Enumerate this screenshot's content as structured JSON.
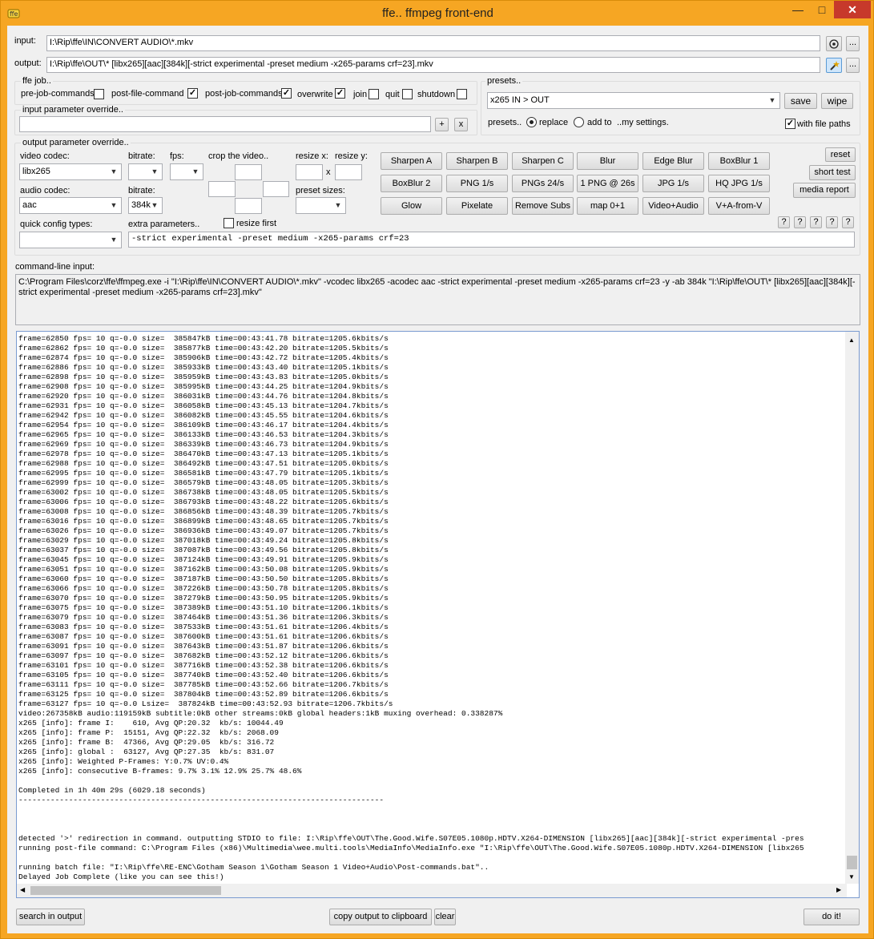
{
  "window": {
    "title": "ffe.. ffmpeg front-end",
    "minimize": "—",
    "maximize": "□",
    "close": "✕"
  },
  "input": {
    "label": "input:",
    "value": "I:\\Rip\\ffe\\IN\\CONVERT AUDIO\\*.mkv"
  },
  "output": {
    "label": "output:",
    "value": "I:\\Rip\\ffe\\OUT\\* [libx265][aac][384k][-strict experimental -preset medium -x265-params crf=23].mkv"
  },
  "browse_label": "...",
  "ffe_job": {
    "label": "ffe job..",
    "options": [
      {
        "label": "pre-job-commands",
        "checked": false
      },
      {
        "label": "post-file-command",
        "checked": true
      },
      {
        "label": "post-job-commands",
        "checked": true
      },
      {
        "label": "overwrite",
        "checked": true
      },
      {
        "label": "join",
        "checked": false
      },
      {
        "label": "quit",
        "checked": false
      },
      {
        "label": "shutdown",
        "checked": false
      }
    ]
  },
  "presets": {
    "label": "presets..",
    "selected": "x265 IN > OUT",
    "save": "save",
    "wipe": "wipe",
    "mode_label": "presets..",
    "replace": "replace",
    "add_to": "add to",
    "my_settings": "..my settings.",
    "with_file_paths": "with file paths"
  },
  "input_override": {
    "label": "input parameter override..",
    "value": "",
    "add": "+",
    "remove": "x"
  },
  "output_override": {
    "label": "output parameter override..",
    "video_codec_label": "video codec:",
    "video_codec": "libx265",
    "bitrate_label": "bitrate:",
    "video_bitrate": "",
    "fps_label": "fps:",
    "fps": "",
    "crop_label": "crop the video..",
    "resize_x_label": "resize x:",
    "resize_y_label": "resize y:",
    "x": "x",
    "audio_codec_label": "audio codec:",
    "audio_codec": "aac",
    "audio_bitrate_label": "bitrate:",
    "audio_bitrate": "384k",
    "preset_sizes_label": "preset sizes:",
    "quick_config_label": "quick config types:",
    "extra_label": "extra parameters..",
    "resize_first": "resize first",
    "extra_value": "-strict experimental -preset medium -x265-params crf=23"
  },
  "filter_buttons": [
    [
      "Sharpen A",
      "Sharpen B",
      "Sharpen C",
      "Blur",
      "Edge Blur",
      "BoxBlur 1"
    ],
    [
      "BoxBlur 2",
      "PNG 1/s",
      "PNGs 24/s",
      "1 PNG @ 26s",
      "JPG 1/s",
      "HQ JPG 1/s"
    ],
    [
      "Glow",
      "Pixelate",
      "Remove Subs",
      "map 0+1",
      "Video+Audio",
      "V+A-from-V"
    ]
  ],
  "side_buttons": {
    "reset": "reset",
    "short_test": "short test",
    "media_report": "media report"
  },
  "help_label": "?",
  "cmdline": {
    "label": "command-line input:",
    "value": "C:\\Program Files\\corz\\ffe\\ffmpeg.exe  -i \"I:\\Rip\\ffe\\IN\\CONVERT AUDIO\\*.mkv\" -vcodec libx265  -acodec aac -strict experimental -preset medium -x265-params crf=23 -y  -ab 384k \"I:\\Rip\\ffe\\OUT\\* [libx265][aac][384k][-strict experimental -preset medium -x265-params crf=23].mkv\""
  },
  "output_log": "frame=62850 fps= 10 q=-0.0 size=  385847kB time=00:43:41.78 bitrate=1205.6kbits/s\nframe=62862 fps= 10 q=-0.0 size=  385877kB time=00:43:42.20 bitrate=1205.5kbits/s\nframe=62874 fps= 10 q=-0.0 size=  385906kB time=00:43:42.72 bitrate=1205.4kbits/s\nframe=62886 fps= 10 q=-0.0 size=  385933kB time=00:43:43.40 bitrate=1205.1kbits/s\nframe=62898 fps= 10 q=-0.0 size=  385959kB time=00:43:43.83 bitrate=1205.0kbits/s\nframe=62908 fps= 10 q=-0.0 size=  385995kB time=00:43:44.25 bitrate=1204.9kbits/s\nframe=62920 fps= 10 q=-0.0 size=  386031kB time=00:43:44.76 bitrate=1204.8kbits/s\nframe=62931 fps= 10 q=-0.0 size=  386058kB time=00:43:45.13 bitrate=1204.7kbits/s\nframe=62942 fps= 10 q=-0.0 size=  386082kB time=00:43:45.55 bitrate=1204.6kbits/s\nframe=62954 fps= 10 q=-0.0 size=  386109kB time=00:43:46.17 bitrate=1204.4kbits/s\nframe=62965 fps= 10 q=-0.0 size=  386133kB time=00:43:46.53 bitrate=1204.3kbits/s\nframe=62969 fps= 10 q=-0.0 size=  386339kB time=00:43:46.73 bitrate=1204.9kbits/s\nframe=62978 fps= 10 q=-0.0 size=  386470kB time=00:43:47.13 bitrate=1205.1kbits/s\nframe=62988 fps= 10 q=-0.0 size=  386492kB time=00:43:47.51 bitrate=1205.0kbits/s\nframe=62995 fps= 10 q=-0.0 size=  386581kB time=00:43:47.79 bitrate=1205.1kbits/s\nframe=62999 fps= 10 q=-0.0 size=  386579kB time=00:43:48.05 bitrate=1205.3kbits/s\nframe=63002 fps= 10 q=-0.0 size=  386738kB time=00:43:48.05 bitrate=1205.5kbits/s\nframe=63006 fps= 10 q=-0.0 size=  386793kB time=00:43:48.22 bitrate=1205.6kbits/s\nframe=63008 fps= 10 q=-0.0 size=  386856kB time=00:43:48.39 bitrate=1205.7kbits/s\nframe=63016 fps= 10 q=-0.0 size=  386899kB time=00:43:48.65 bitrate=1205.7kbits/s\nframe=63026 fps= 10 q=-0.0 size=  386936kB time=00:43:49.07 bitrate=1205.7kbits/s\nframe=63029 fps= 10 q=-0.0 size=  387018kB time=00:43:49.24 bitrate=1205.8kbits/s\nframe=63037 fps= 10 q=-0.0 size=  387087kB time=00:43:49.56 bitrate=1205.8kbits/s\nframe=63045 fps= 10 q=-0.0 size=  387124kB time=00:43:49.91 bitrate=1205.9kbits/s\nframe=63051 fps= 10 q=-0.0 size=  387162kB time=00:43:50.08 bitrate=1205.9kbits/s\nframe=63060 fps= 10 q=-0.0 size=  387187kB time=00:43:50.50 bitrate=1205.8kbits/s\nframe=63066 fps= 10 q=-0.0 size=  387226kB time=00:43:50.78 bitrate=1205.8kbits/s\nframe=63070 fps= 10 q=-0.0 size=  387279kB time=00:43:50.95 bitrate=1205.9kbits/s\nframe=63075 fps= 10 q=-0.0 size=  387389kB time=00:43:51.10 bitrate=1206.1kbits/s\nframe=63079 fps= 10 q=-0.0 size=  387464kB time=00:43:51.36 bitrate=1206.3kbits/s\nframe=63083 fps= 10 q=-0.0 size=  387533kB time=00:43:51.61 bitrate=1206.4kbits/s\nframe=63087 fps= 10 q=-0.0 size=  387600kB time=00:43:51.61 bitrate=1206.6kbits/s\nframe=63091 fps= 10 q=-0.0 size=  387643kB time=00:43:51.87 bitrate=1206.6kbits/s\nframe=63097 fps= 10 q=-0.0 size=  387682kB time=00:43:52.12 bitrate=1206.6kbits/s\nframe=63101 fps= 10 q=-0.0 size=  387716kB time=00:43:52.38 bitrate=1206.6kbits/s\nframe=63105 fps= 10 q=-0.0 size=  387740kB time=00:43:52.40 bitrate=1206.6kbits/s\nframe=63111 fps= 10 q=-0.0 size=  387785kB time=00:43:52.66 bitrate=1206.7kbits/s\nframe=63125 fps= 10 q=-0.0 size=  387804kB time=00:43:52.89 bitrate=1206.6kbits/s\nframe=63127 fps= 10 q=-0.0 Lsize=  387824kB time=00:43:52.93 bitrate=1206.7kbits/s\nvideo:267358kB audio:119159kB subtitle:0kB other streams:0kB global headers:1kB muxing overhead: 0.338287%\nx265 [info]: frame I:    610, Avg QP:20.32  kb/s: 10044.49\nx265 [info]: frame P:  15151, Avg QP:22.32  kb/s: 2068.09\nx265 [info]: frame B:  47366, Avg QP:29.05  kb/s: 316.72\nx265 [info]: global :  63127, Avg QP:27.35  kb/s: 831.07\nx265 [info]: Weighted P-Frames: Y:0.7% UV:0.4%\nx265 [info]: consecutive B-frames: 9.7% 3.1% 12.9% 25.7% 48.6%\n\nCompleted in 1h 40m 29s (6029.18 seconds)\n--------------------------------------------------------------------------------\n\n\n\ndetected '>' redirection in command. outputting STDIO to file: I:\\Rip\\ffe\\OUT\\The.Good.Wife.S07E05.1080p.HDTV.X264-DIMENSION [libx265][aac][384k][-strict experimental -pres\nrunning post-file command: C:\\Program Files (x86)\\Multimedia\\wee.multi.tools\\MediaInfo\\MediaInfo.exe \"I:\\Rip\\ffe\\OUT\\The.Good.Wife.S07E05.1080p.HDTV.X264-DIMENSION [libx265\n\nrunning batch file: \"I:\\Rip\\ffe\\RE-ENC\\Gotham Season 1\\Gotham Season 1 Video+Audio\\Post-commands.bat\"..\nDelayed Job Complete (like you can see this!)",
  "bottom": {
    "search": "search in output",
    "copy": "copy output to clipboard",
    "clear": "clear",
    "doit": "do it!"
  }
}
